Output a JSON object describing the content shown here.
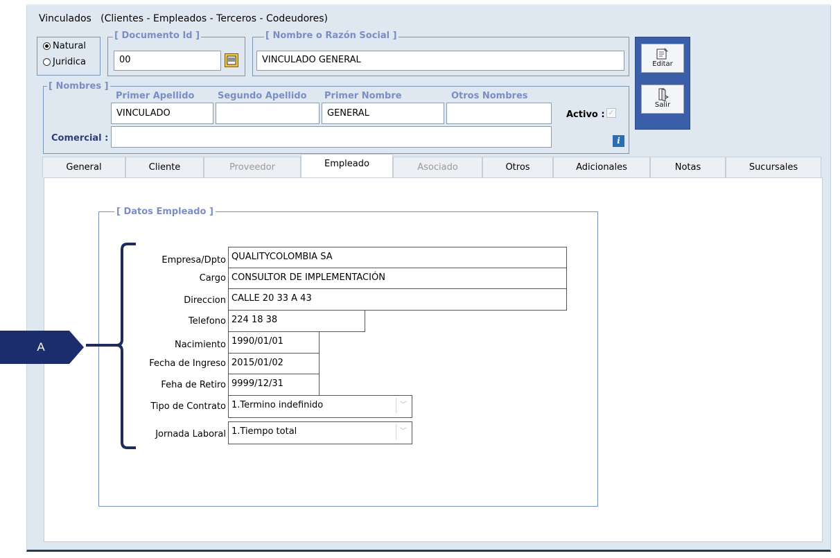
{
  "title": "Vinculados   (Clientes - Empleados - Terceros - Codeudores)",
  "person_type": {
    "natural": "Natural",
    "juridica": "Juridica"
  },
  "documento": {
    "label": "[ Documento Id ]",
    "value": "00"
  },
  "razon_social": {
    "label": "[ Nombre o Razón Social ]",
    "value": "VINCULADO GENERAL"
  },
  "nombres": {
    "label": "[ Nombres ]",
    "primer_apellido_hdr": "Primer Apellido",
    "segundo_apellido_hdr": "Segundo Apellido",
    "primer_nombre_hdr": "Primer Nombre",
    "otros_nombres_hdr": "Otros Nombres",
    "primer_apellido": "VINCULADO",
    "segundo_apellido": "",
    "primer_nombre": "GENERAL",
    "otros_nombres": "",
    "activo_label": "Activo :",
    "comercial_label": "Comercial :",
    "comercial": ""
  },
  "buttons": {
    "editar": "Editar",
    "salir": "Salir"
  },
  "tabs": [
    {
      "label": "General"
    },
    {
      "label": "Cliente"
    },
    {
      "label": "Proveedor"
    },
    {
      "label": "Empleado"
    },
    {
      "label": "Asociado"
    },
    {
      "label": "Otros"
    },
    {
      "label": "Adicionales"
    },
    {
      "label": "Notas"
    },
    {
      "label": "Sucursales"
    }
  ],
  "empleado": {
    "group_label": "[ Datos Empleado ]",
    "empresa_label": "Empresa/Dpto",
    "empresa": "QUALITYCOLOMBIA SA",
    "cargo_label": "Cargo",
    "cargo": "CONSULTOR DE IMPLEMENTACIÓN",
    "direccion_label": "Direccion",
    "direccion": "CALLE 20 33 A 43",
    "telefono_label": "Telefono",
    "telefono": "224 18 38",
    "nacimiento_label": "Nacimiento",
    "nacimiento": "1990/01/01",
    "ingreso_label": "Fecha de Ingreso",
    "ingreso": "2015/01/02",
    "retiro_label": "Feha de Retiro",
    "retiro": "9999/12/31",
    "contrato_label": "Tipo de Contrato",
    "contrato": "1.Termino indefinido",
    "jornada_label": "Jornada Laboral",
    "jornada": "1.Tiempo total"
  },
  "callout": {
    "label": "A"
  },
  "colors": {
    "bracket": "#1f2b5a",
    "callout_bg": "#1c2d6e",
    "accent": "#3b5ea8"
  }
}
